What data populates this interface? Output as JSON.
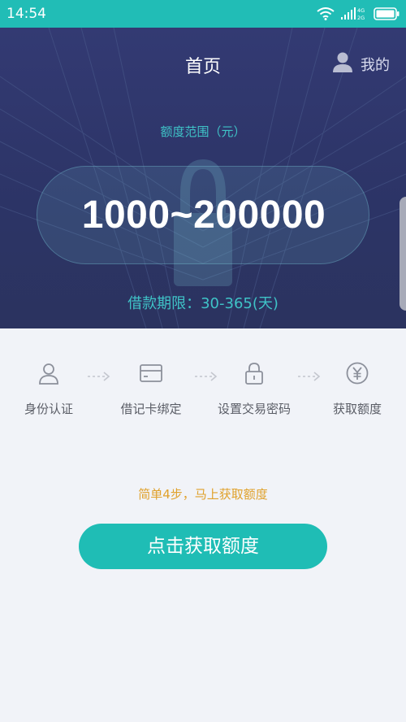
{
  "status_bar": {
    "time": "14:54",
    "network_4g": "4G",
    "network_2g": "2G",
    "icons": [
      "wifi-icon",
      "signal-icon",
      "battery-icon"
    ]
  },
  "header": {
    "title": "首页",
    "mine_label": "我的",
    "mine_icon": "user-icon"
  },
  "hero": {
    "range_label": "额度范围（元）",
    "range_value": "1000~200000",
    "term_label": "借款期限：30-365(天)",
    "background_icon": "lock-icon"
  },
  "steps": [
    {
      "label": "身份认证",
      "icon": "person-icon"
    },
    {
      "label": "借记卡绑定",
      "icon": "card-icon"
    },
    {
      "label": "设置交易密码",
      "icon": "lock-icon"
    },
    {
      "label": "获取额度",
      "icon": "yen-icon"
    }
  ],
  "hint": "简单4步，马上获取额度",
  "cta": {
    "label": "点击获取额度"
  },
  "colors": {
    "accent": "#21bdb6",
    "hero_bg": "#2f366c",
    "highlight_text": "#3fc3c7",
    "hint_text": "#e0a12b",
    "page_bg": "#f1f3f8"
  }
}
